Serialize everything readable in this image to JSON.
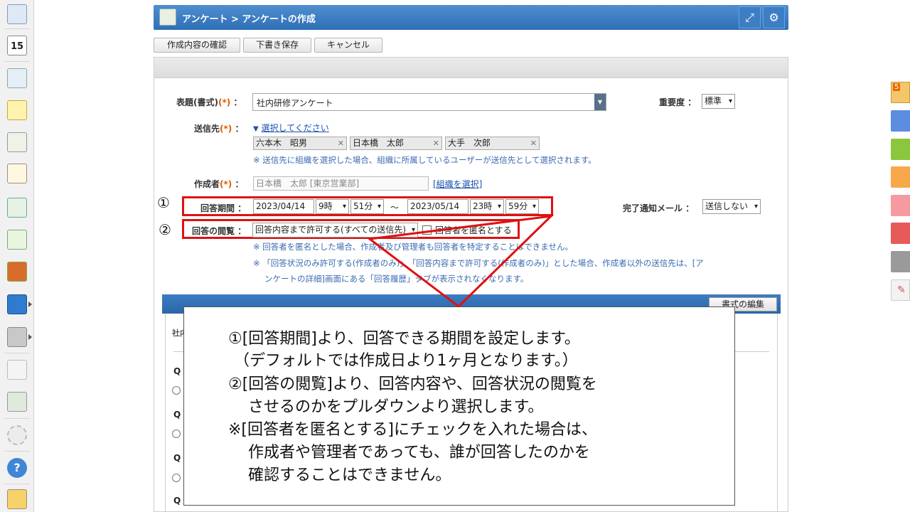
{
  "header": {
    "title": "アンケート > アンケートの作成",
    "expand_icon": "expand-icon",
    "settings_icon": "gear-icon"
  },
  "toolbar": {
    "confirm_label": "作成内容の確認",
    "draft_label": "下書き保存",
    "cancel_label": "キャンセル"
  },
  "sidebar": {
    "calendar_day": "15"
  },
  "right_tabs": {
    "badge": "5"
  },
  "form": {
    "subject_label": "表題(書式)",
    "required_mark": "(*)",
    "colon": "：",
    "subject_value": "社内研修アンケート",
    "importance_label": "重要度 ：",
    "importance_value": "標準",
    "recipients_label": "送信先",
    "recipients_select_link": "選択してください",
    "recipients": [
      "六本木　昭男",
      "日本橋　太郎",
      "大手　次郎"
    ],
    "recipients_note": "※ 送信先に組織を選択した場合、組織に所属しているユーザーが送信先として選択されます。",
    "creator_label": "作成者",
    "creator_value": "日本橋　太郎 [東京営業部]",
    "org_select_link": "[組織を選択]",
    "period_label": "回答期間 ：",
    "period_start_date": "2023/04/14",
    "period_start_hour": "9時",
    "period_start_min": "51分",
    "period_sep": "～",
    "period_end_date": "2023/05/14",
    "period_end_hour": "23時",
    "period_end_min": "59分",
    "completion_mail_label": "完了通知メール ：",
    "completion_mail_value": "送信しない",
    "view_label": "回答の閲覧 ：",
    "view_value": "回答内容まで許可する(すべての送信先)",
    "anonymous_label": "回答者を匿名とする",
    "view_note1": "※ 回答者を匿名とした場合、作成者及び管理者も回答者を特定することはできません。",
    "view_note2a": "※ 「回答状況のみ許可する(作成者のみ)」、「回答内容まで許可する(作成者のみ)」とした場合、作成者以外の送信先は、[ア",
    "view_note2b": "ンケートの詳細]画面にある「回答履歴」タブが表示されなくなります。",
    "format_edit_label": "書式の編集",
    "form_title_partial": "社内",
    "question_marks": [
      "Q",
      "Q",
      "Q",
      "Q"
    ]
  },
  "annotations": {
    "num1": "①",
    "num2": "②"
  },
  "callout": {
    "lines": [
      "①[回答期間]より、回答できる期間を設定します。",
      "（デフォルトでは作成日より1ヶ月となります。）",
      "②[回答の閲覧]より、回答内容や、回答状況の閲覧を",
      "させるのかをプルダウンより選択します。",
      "※[回答者を匿名とする]にチェックを入れた場合は、",
      "作成者や管理者であっても、誰が回答したのかを",
      "確認することはできません。"
    ]
  },
  "colors": {
    "header_blue": "#2f6fb6",
    "highlight_red": "#e01010",
    "required_orange": "#e05a00",
    "note_blue": "#3a6bb0"
  }
}
